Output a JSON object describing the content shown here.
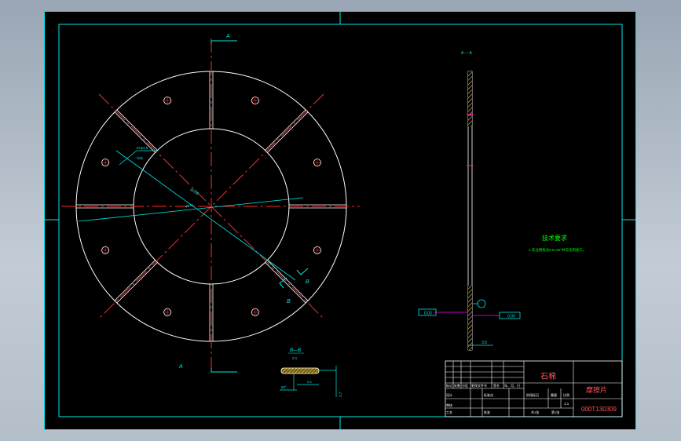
{
  "section_views": {
    "main_label_top": "A",
    "main_label_bottom": "A",
    "section_label": "A — A",
    "cut_label_1": "B",
    "cut_label_2": "B",
    "detail_label": "B—B",
    "detail_scale": "2:1"
  },
  "dimensions": {
    "hole_callout": "8×φ4.5",
    "hole_callout_sub": "均布",
    "outer_dia": "φ256",
    "inner_dia": "φ145",
    "thickness": "3.5",
    "flatness": "0.03",
    "parallelism": "0.05",
    "detail_dim": "3.7",
    "detail_angle": "60°",
    "detail_depth": "0.5"
  },
  "notes": {
    "title": "技术要求",
    "line1": "1.未注倒角为0.5×45°并去毛刺加工。"
  },
  "title_block": {
    "material": "石棉",
    "part_name": "摩擦片",
    "drawing_no": "000T130309",
    "scale": "1:1",
    "row_labels": [
      "标记",
      "处数",
      "分区",
      "更改文件号",
      "签名",
      "年、月、日"
    ],
    "design": "设计",
    "std": "标准化",
    "review": "审核",
    "process": "工艺",
    "approve": "批准",
    "stage_label": "阶段标记",
    "weight_label": "重量",
    "scale_label": "比例",
    "sheets": "共1张",
    "sheet_no": "第1张"
  },
  "colors": {
    "background": "#000000",
    "outline": "#ffffff",
    "center_line": "#ff2a2a",
    "dimension": "#00e6e6",
    "text_green": "#00ff00",
    "frame": "#00e6e6",
    "magenta": "#ff00ff",
    "hatch": "#ffd24a"
  }
}
